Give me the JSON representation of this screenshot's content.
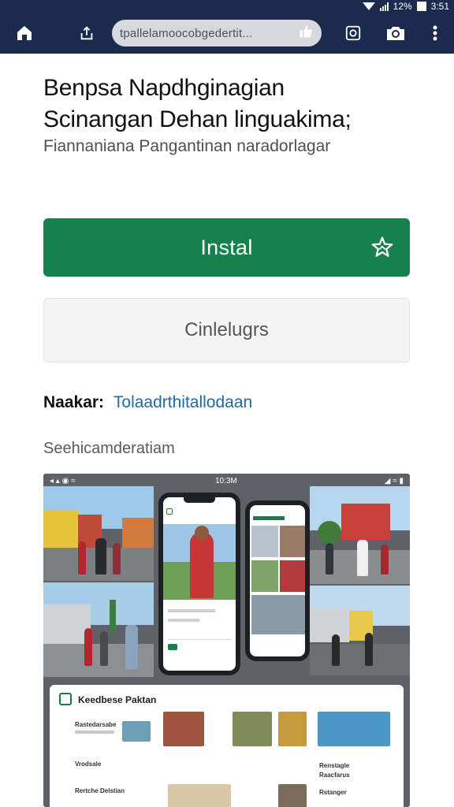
{
  "status_bar": {
    "battery_text": "12%",
    "time": "3:51"
  },
  "browser": {
    "url": "tpallelamoocobgedertit...",
    "icons": [
      "home-icon",
      "share-icon",
      "thumbs-up-icon",
      "tabs-icon",
      "camera-icon",
      "more-vert-icon"
    ]
  },
  "app": {
    "title_line1": "Benpsa Napdhginagian",
    "title_line2": "Scinangan  Dehan linguakima;",
    "subtitle": "Fiannaniana Pangantinan naradorlagar",
    "install_label": "Instal",
    "secondary_label": "Cinlelugrs",
    "developer_label": "Naakar:",
    "developer_name": "Tolaadrthitallodaan",
    "screenshots_label": "Seehicamderatiam"
  },
  "screenshot_panel": {
    "status_time": "10:3M",
    "card_title": "Keedbese Paktan",
    "card_rows": [
      {
        "label": "Rastedarsabe"
      },
      {
        "label": "Vrodsale"
      },
      {
        "label": "Rertche Delstian"
      }
    ],
    "right_rows": [
      {
        "label": "Renstagle"
      },
      {
        "label": "Raacfarus"
      },
      {
        "label": "Rstanger"
      }
    ]
  },
  "colors": {
    "toolbar": "#1c2a4e",
    "install": "#17814d",
    "link": "#1e6aa6"
  }
}
